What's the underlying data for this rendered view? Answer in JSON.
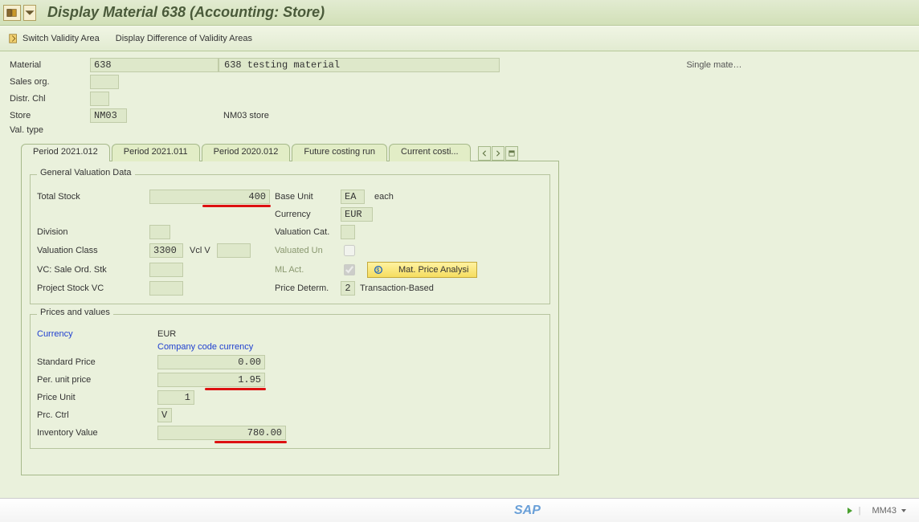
{
  "title": "Display Material 638 (Accounting: Store)",
  "toolbar": {
    "switch_validity": "Switch Validity Area",
    "display_diff": "Display Difference of Validity Areas"
  },
  "header": {
    "material_label": "Material",
    "material_value": "638",
    "material_desc": "638 testing material",
    "single_mate": "Single mate…",
    "sales_org_label": "Sales org.",
    "sales_org_value": "",
    "distr_chl_label": "Distr. Chl",
    "distr_chl_value": "",
    "store_label": "Store",
    "store_value": "NM03",
    "store_desc": "NM03 store",
    "val_type_label": "Val. type"
  },
  "tabs": [
    {
      "label": "Period 2021.012"
    },
    {
      "label": "Period 2021.011"
    },
    {
      "label": "Period 2020.012"
    },
    {
      "label": "Future costing run"
    },
    {
      "label": "Current costi..."
    }
  ],
  "gv": {
    "title": "General Valuation Data",
    "total_stock_label": "Total Stock",
    "total_stock_value": "400",
    "base_unit_label": "Base Unit",
    "base_unit_value": "EA",
    "base_unit_desc": "each",
    "currency_label": "Currency",
    "currency_value": "EUR",
    "division_label": "Division",
    "division_value": "",
    "valuation_cat_label": "Valuation Cat.",
    "valuation_cat_value": "",
    "valuation_class_label": "Valuation Class",
    "valuation_class_value": "3300",
    "vcl_v_label": "Vcl V",
    "vcl_v_value": "",
    "valuated_un_label": "Valuated Un",
    "vc_sale_ord_label": "VC: Sale Ord. Stk",
    "vc_sale_ord_value": "",
    "ml_act_label": "ML Act.",
    "mat_price_btn": "Mat. Price Analysi",
    "project_stock_label": "Project Stock VC",
    "project_stock_value": "",
    "price_determ_label": "Price Determ.",
    "price_determ_value": "2",
    "price_determ_desc": "Transaction-Based"
  },
  "pv": {
    "title": "Prices and values",
    "currency_label": "Currency",
    "currency_value": "EUR",
    "cc_currency": "Company code currency",
    "std_price_label": "Standard Price",
    "std_price_value": "0.00",
    "per_unit_label": "Per. unit price",
    "per_unit_value": "1.95",
    "price_unit_label": "Price Unit",
    "price_unit_value": "1",
    "prc_ctrl_label": "Prc. Ctrl",
    "prc_ctrl_value": "V",
    "inv_value_label": "Inventory Value",
    "inv_value_value": "780.00"
  },
  "status": {
    "tcode": "MM43"
  }
}
